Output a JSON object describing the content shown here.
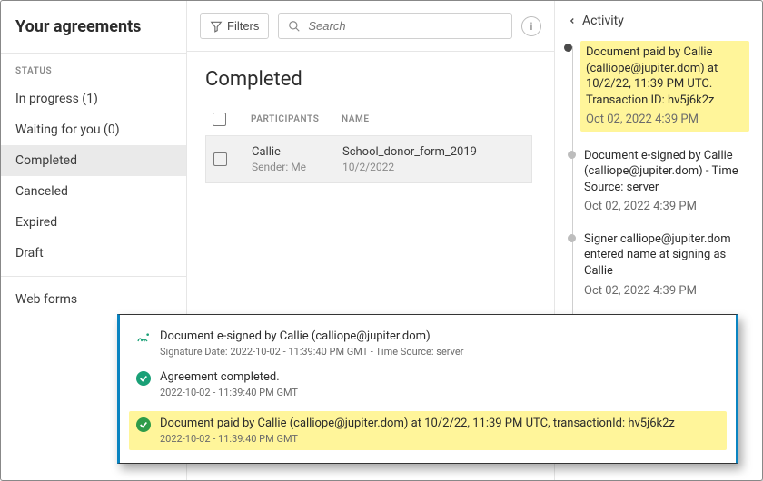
{
  "sidebar": {
    "title": "Your agreements",
    "filters_label": "Filters",
    "status_heading": "STATUS",
    "items": [
      {
        "label": "In progress (1)"
      },
      {
        "label": "Waiting for you (0)"
      },
      {
        "label": "Completed"
      },
      {
        "label": "Canceled"
      },
      {
        "label": "Expired"
      },
      {
        "label": "Draft"
      }
    ],
    "extra_item": "Web forms"
  },
  "header": {
    "search_placeholder": "Search"
  },
  "content": {
    "heading": "Completed",
    "columns": {
      "participants": "PARTICIPANTS",
      "name": "NAME"
    },
    "rows": [
      {
        "participant": "Callie",
        "sender": "Sender: Me",
        "name": "School_donor_form_2019",
        "date": "10/2/2022"
      }
    ]
  },
  "activity": {
    "title": "Activity",
    "events": [
      {
        "text": "Document paid by Callie (calliope@jupiter.dom) at 10/2/22, 11:39 PM UTC. Transaction ID: hv5j6k2z",
        "time": "Oct 02, 2022 4:39 PM",
        "highlight": true,
        "filled": true
      },
      {
        "text": "Document e-signed by Callie (calliope@jupiter.dom) - Time Source: server",
        "time": "Oct 02, 2022 4:39 PM",
        "highlight": false,
        "filled": false
      },
      {
        "text": "Signer calliope@jupiter.dom entered name at signing as Callie",
        "time": "Oct 02, 2022 4:39 PM",
        "highlight": false,
        "filled": false
      }
    ]
  },
  "audit": {
    "entries": [
      {
        "kind": "sign",
        "title": "Document e-signed by Callie (calliope@jupiter.dom)",
        "sub": "Signature Date: 2022-10-02 - 11:39:40 PM GMT - Time Source: server"
      },
      {
        "kind": "check",
        "title": "Agreement completed.",
        "sub": "2022-10-02 - 11:39:40 PM GMT"
      },
      {
        "kind": "paid",
        "title": "Document paid by Callie (calliope@jupiter.dom) at 10/2/22, 11:39 PM UTC, transactionId: hv5j6k2z",
        "sub": "2022-10-02 - 11:39:40 PM GMT",
        "highlight": true
      }
    ]
  }
}
